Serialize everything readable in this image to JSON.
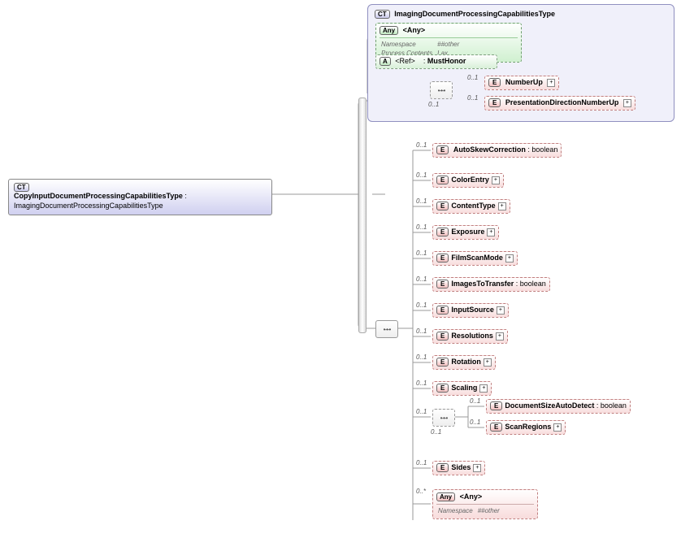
{
  "root": {
    "name": "CopyInputDocumentProcessingCapabilitiesType",
    "base": "ImagingDocumentProcessingCapabilitiesType",
    "badge": "CT"
  },
  "ext": {
    "name": "ImagingDocumentProcessingCapabilitiesType",
    "badge": "CT"
  },
  "any_top": {
    "label": "<Any>",
    "badge": "Any",
    "ns_label": "Namespace",
    "ns_val": "##other",
    "pc_label": "Process Contents",
    "pc_val": "Lax"
  },
  "ref": {
    "label": "<Ref>",
    "name": "MustHonor",
    "badge": "A"
  },
  "inner_seq": {
    "occ": "0..1",
    "items": [
      {
        "name": "NumberUp",
        "occ": "0..1"
      },
      {
        "name": "PresentationDirectionNumberUp",
        "occ": "0..1"
      }
    ]
  },
  "seq": [
    {
      "name": "AutoSkewCorrection",
      "type": "boolean",
      "occ": "0..1"
    },
    {
      "name": "ColorEntry",
      "occ": "0..1",
      "expand": true
    },
    {
      "name": "ContentType",
      "occ": "0..1",
      "expand": true
    },
    {
      "name": "Exposure",
      "occ": "0..1",
      "expand": true
    },
    {
      "name": "FilmScanMode",
      "occ": "0..1",
      "expand": true
    },
    {
      "name": "ImagesToTransfer",
      "type": "boolean",
      "occ": "0..1"
    },
    {
      "name": "InputSource",
      "occ": "0..1",
      "expand": true
    },
    {
      "name": "Resolutions",
      "occ": "0..1",
      "expand": true
    },
    {
      "name": "Rotation",
      "occ": "0..1",
      "expand": true
    },
    {
      "name": "Scaling",
      "occ": "0..1",
      "expand": true
    }
  ],
  "nested_seq": {
    "occ": "0..1",
    "items": [
      {
        "name": "DocumentSizeAutoDetect",
        "type": "boolean",
        "occ": "0..1"
      },
      {
        "name": "ScanRegions",
        "occ": "0..1",
        "expand": true
      }
    ]
  },
  "tail": [
    {
      "name": "Sides",
      "occ": "0..1",
      "expand": true
    }
  ],
  "any_bottom": {
    "label": "<Any>",
    "badge": "Any",
    "occ": "0..*",
    "ns_label": "Namespace",
    "ns_val": "##other"
  },
  "badge_e": "E",
  "colon": " : "
}
